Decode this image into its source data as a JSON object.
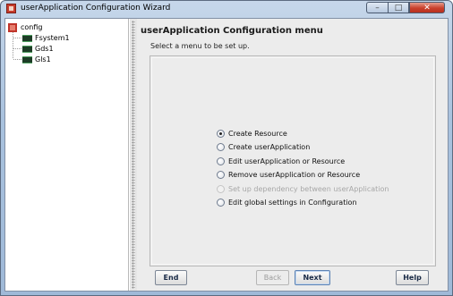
{
  "window": {
    "title": "userApplication Configuration Wizard",
    "controls": {
      "minimize": "–",
      "maximize": "□",
      "close": "✕"
    }
  },
  "tree": {
    "root": "config",
    "children": [
      "Fsystem1",
      "Gds1",
      "Gls1"
    ]
  },
  "main": {
    "title": "userApplication Configuration menu",
    "subtitle": "Select a menu to be set up.",
    "options": [
      {
        "label": "Create Resource",
        "selected": true,
        "enabled": true
      },
      {
        "label": "Create userApplication",
        "selected": false,
        "enabled": true
      },
      {
        "label": "Edit userApplication or Resource",
        "selected": false,
        "enabled": true
      },
      {
        "label": "Remove userApplication or Resource",
        "selected": false,
        "enabled": true
      },
      {
        "label": "Set up dependency between userApplication",
        "selected": false,
        "enabled": false
      },
      {
        "label": "Edit global settings in Configuration",
        "selected": false,
        "enabled": true
      }
    ]
  },
  "buttons": {
    "end": "End",
    "back": "Back",
    "next": "Next",
    "help": "Help"
  },
  "colors": {
    "accent": "#c73c2c",
    "titlebar": "#a9c2de",
    "close_button": "#c9402b"
  }
}
